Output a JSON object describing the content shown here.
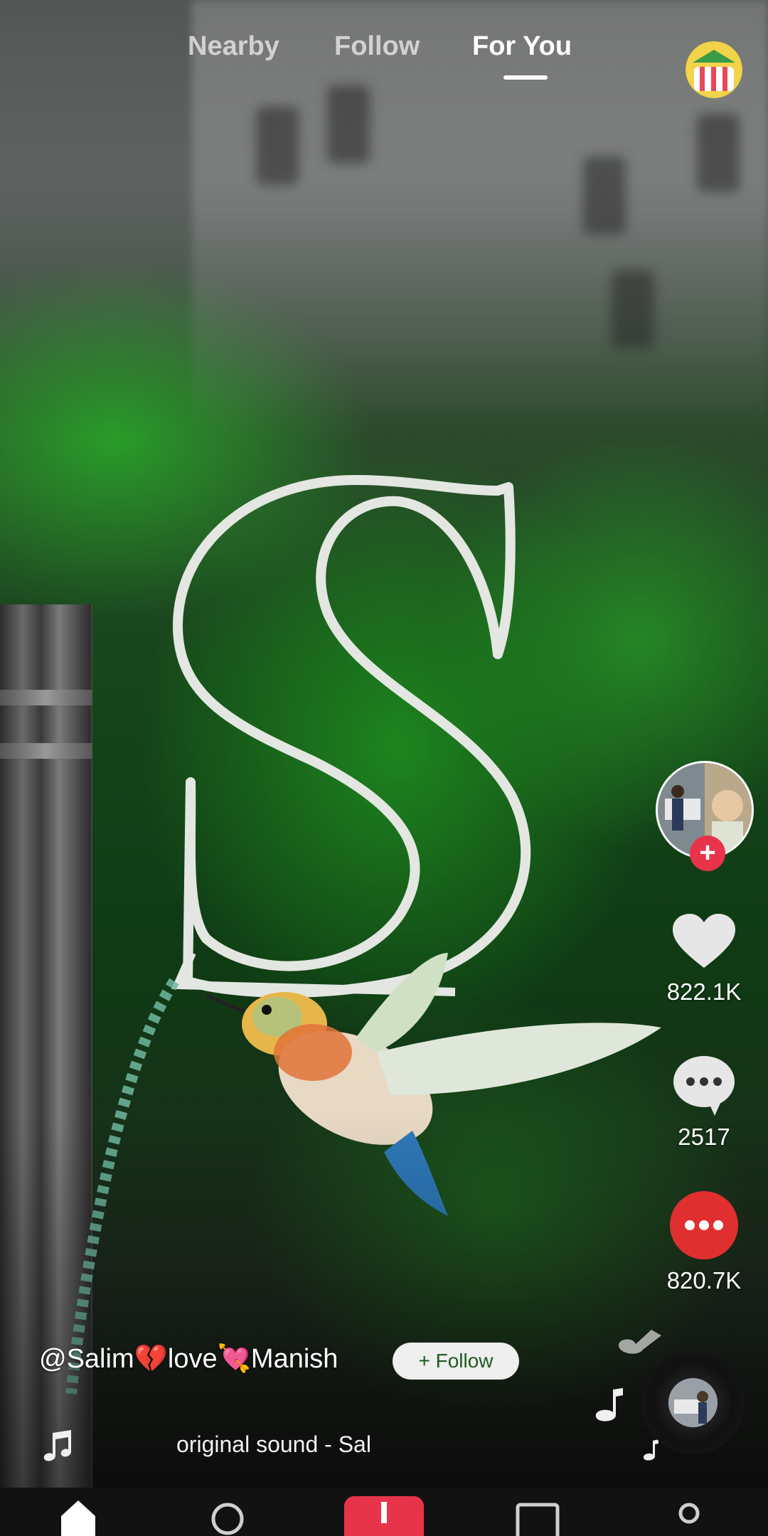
{
  "top_tabs": [
    {
      "label": "Nearby",
      "active": false
    },
    {
      "label": "Follow",
      "active": false
    },
    {
      "label": "For You",
      "active": true
    }
  ],
  "profile_icon": "profile-avatar-icon",
  "video": {
    "overlay_art": "letter-s-outline-with-hummingbird"
  },
  "side_actions": {
    "likes": "822.1K",
    "comments": "2517",
    "shares": "820.7K"
  },
  "caption": {
    "username": "@Salim💔love💘Manish",
    "follow_label": "+ Follow"
  },
  "sound": {
    "label": "original sound - Sal"
  },
  "colors": {
    "accent_red": "#e8344a",
    "share_red": "#e02f2f",
    "nav_bg": "#121212"
  },
  "bottom_nav": {
    "items": [
      "home-icon",
      "search-icon",
      "create-icon",
      "inbox-icon",
      "profile-icon"
    ]
  }
}
